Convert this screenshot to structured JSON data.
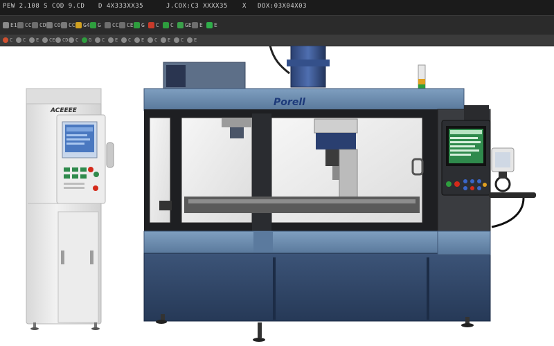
{
  "titlebar": {
    "segments": [
      "PEW 2.108 S COD 9.CD",
      "D 4X333XX35",
      "J.COX:C3 XXXX35",
      "X",
      "DOX:03X04X03"
    ]
  },
  "toolbar": {
    "items": [
      {
        "label": "E1",
        "color": "#8a8a8a"
      },
      {
        "label": "CCE",
        "color": "#6e6e6e"
      },
      {
        "label": "CD3",
        "color": "#6e6e6e"
      },
      {
        "label": "COE",
        "color": "#7a7a7a"
      },
      {
        "label": "CCE",
        "color": "#7a7a7a"
      },
      {
        "label": "G4",
        "color": "#d0a020"
      },
      {
        "label": "G",
        "color": "#2e9e3e"
      },
      {
        "label": "CC",
        "color": "#6e6e6e"
      },
      {
        "label": "CE",
        "color": "#6e6e6e"
      },
      {
        "label": "G",
        "color": "#2e9e3e"
      },
      {
        "label": "C",
        "color": "#c83a2a"
      },
      {
        "label": "C",
        "color": "#2e9e3e"
      },
      {
        "label": "GE",
        "color": "#3aa04a"
      },
      {
        "label": "E",
        "color": "#6e6e6e"
      },
      {
        "label": "E",
        "color": "#2fae4a"
      }
    ]
  },
  "ribbon": {
    "items": [
      {
        "label": "C",
        "color": "#d05030"
      },
      {
        "label": "C",
        "color": "#8a8a8a"
      },
      {
        "label": "E",
        "color": "#8a8a8a"
      },
      {
        "label": "CE",
        "color": "#8a8a8a"
      },
      {
        "label": "CD",
        "color": "#8a8a8a"
      },
      {
        "label": "C",
        "color": "#8a8a8a"
      },
      {
        "label": "G",
        "color": "#2e9e3e"
      },
      {
        "label": "C",
        "color": "#8a8a8a"
      },
      {
        "label": "E",
        "color": "#8a8a8a"
      },
      {
        "label": "C",
        "color": "#8a8a8a"
      },
      {
        "label": "E",
        "color": "#8a8a8a"
      },
      {
        "label": "C",
        "color": "#8a8a8a"
      },
      {
        "label": "E",
        "color": "#8a8a8a"
      },
      {
        "label": "C",
        "color": "#8a8a8a"
      },
      {
        "label": "E",
        "color": "#8a8a8a"
      }
    ]
  },
  "scene": {
    "cabinet_brand": "ACEEEE",
    "machine_brand": "Porell",
    "colors": {
      "machine_blue": "#6f8fb0",
      "machine_dark": "#2f4566",
      "frame_black": "#1e1f22",
      "cabinet_white": "#e9e9e9",
      "screen_blue": "#4a78c0",
      "screen_green": "#2f8a4c"
    }
  }
}
